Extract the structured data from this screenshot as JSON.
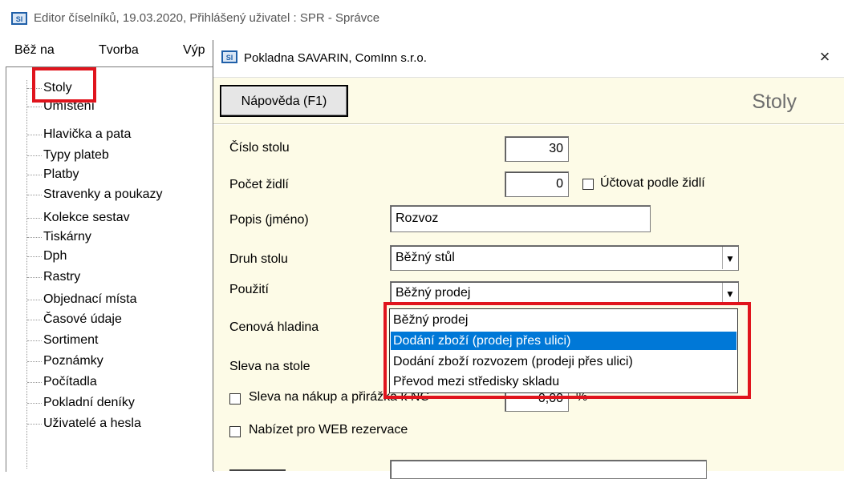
{
  "main_window": {
    "title": "Editor číselníků, 19.03.2020, Přihlášený uživatel : SPR - Správce",
    "app_icon": "app-logo-icon"
  },
  "menu": {
    "items": [
      {
        "label": "Běž na"
      },
      {
        "label": "Tvorba"
      },
      {
        "label": "Výp"
      }
    ]
  },
  "tree": {
    "items": [
      {
        "label": "Stoly"
      },
      {
        "label": "Umístění"
      },
      {
        "label": "Hlavička a pata"
      },
      {
        "label": "Typy plateb"
      },
      {
        "label": "Platby"
      },
      {
        "label": "Stravenky a poukazy"
      },
      {
        "label": "Kolekce sestav"
      },
      {
        "label": "Tiskárny"
      },
      {
        "label": "Dph"
      },
      {
        "label": "Rastry"
      },
      {
        "label": "Objednací místa"
      },
      {
        "label": "Časové údaje"
      },
      {
        "label": "Sortiment"
      },
      {
        "label": "Poznámky"
      },
      {
        "label": "Počítadla"
      },
      {
        "label": "Pokladní deníky"
      },
      {
        "label": "Uživatelé a hesla"
      }
    ]
  },
  "dialog": {
    "title": "Pokladna SAVARIN, ComInn s.r.o.",
    "close_label": "×",
    "help_button": "Nápověda (F1)",
    "heading": "Stoly",
    "fields": {
      "table_number_label": "Číslo stolu",
      "table_number_value": "30",
      "chairs_label": "Počet židlí",
      "chairs_value": "0",
      "bill_by_chairs_label": "Účtovat podle židlí",
      "description_label": "Popis (jméno)",
      "description_value": "Rozvoz",
      "table_kind_label": "Druh stolu",
      "table_kind_value": "Běžný stůl",
      "usage_label": "Použití",
      "usage_value": "Běžný prodej",
      "price_level_label": "Cenová hladina",
      "table_discount_label": "Sleva na stole",
      "purchase_discount_label": "Sleva na nákup a přirážka k NC",
      "purchase_discount_value": "0,00",
      "purchase_discount_unit": "%",
      "web_reservation_label": "Nabízet pro WEB rezervace"
    },
    "dropdown_options": [
      {
        "label": "Běžný prodej",
        "selected": false
      },
      {
        "label": "Dodání zboží (prodej přes ulici)",
        "selected": true
      },
      {
        "label": "Dodání zboží rozvozem (prodeji přes ulici)",
        "selected": false
      },
      {
        "label": "Převod mezi středisky skladu",
        "selected": false
      }
    ]
  },
  "colors": {
    "highlight_red": "#e0141d",
    "selection_blue": "#0078d7",
    "dialog_bg": "#fdfbe7"
  }
}
